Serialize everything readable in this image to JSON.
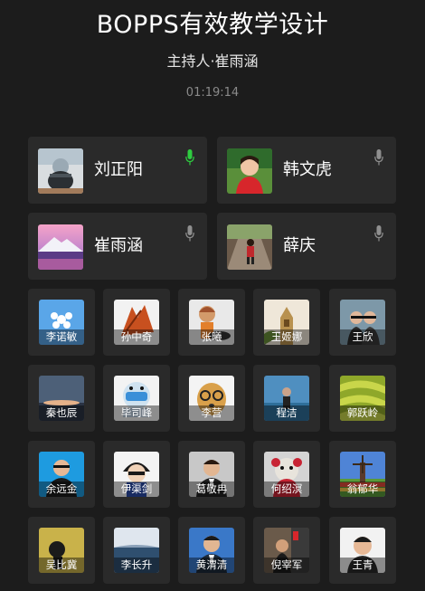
{
  "meeting": {
    "title": "BOPPS有效教学设计",
    "host": "主持人·崔雨涵",
    "timer": "01:19:14"
  },
  "featured": [
    {
      "name": "刘正阳",
      "mic": "active",
      "mic_color": "#2ecc40"
    },
    {
      "name": "韩文虎",
      "mic": "muted"
    },
    {
      "name": "崔雨涵",
      "mic": "muted"
    },
    {
      "name": "薛庆",
      "mic": "muted"
    }
  ],
  "participants": [
    {
      "name": "李诺敏"
    },
    {
      "name": "孙中奇"
    },
    {
      "name": "张曦"
    },
    {
      "name": "王姬娜"
    },
    {
      "name": "王欣"
    },
    {
      "name": "秦也辰"
    },
    {
      "name": "毕司峰"
    },
    {
      "name": "李营"
    },
    {
      "name": "程洁"
    },
    {
      "name": "郭跃岭"
    },
    {
      "name": "余远金"
    },
    {
      "name": "伊渠剑"
    },
    {
      "name": "葛敬冉"
    },
    {
      "name": "何绍溟"
    },
    {
      "name": "翁郁华"
    },
    {
      "name": "吴比冀"
    },
    {
      "name": "李长升"
    },
    {
      "name": "黄渭清"
    },
    {
      "name": "倪宰军"
    },
    {
      "name": "王青"
    }
  ],
  "colors": {
    "background": "#1c1c1c",
    "card": "#2a2a2a",
    "mic_active": "#2ecc40",
    "mic_muted": "#8f8f8f"
  }
}
